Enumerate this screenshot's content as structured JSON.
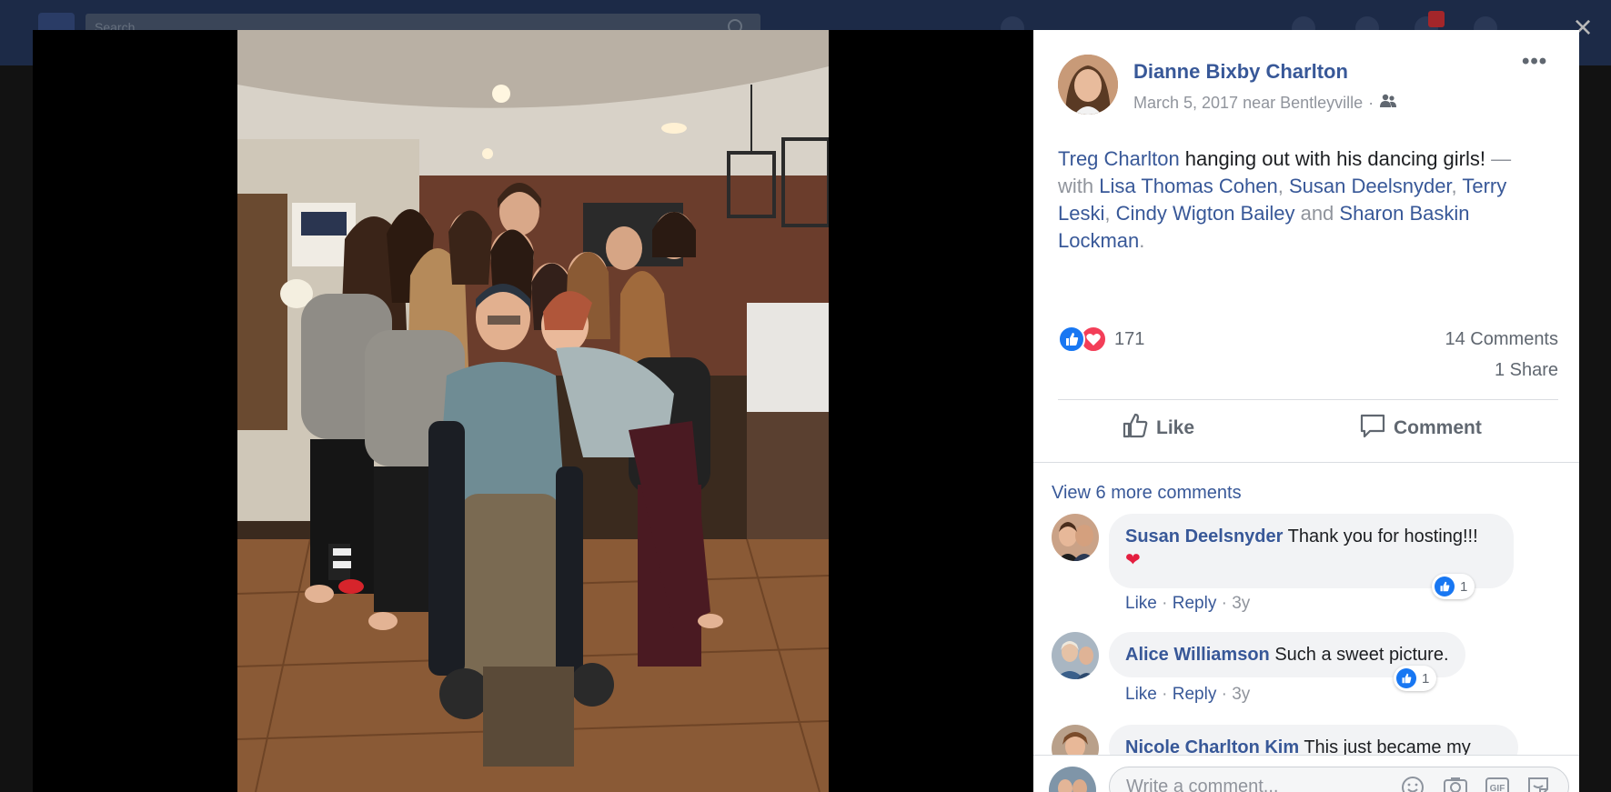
{
  "background": {
    "search_placeholder": "Search"
  },
  "close": {
    "label": "×"
  },
  "post": {
    "author": "Dianne Bixby Charlton",
    "date_location": "March 5, 2017 near Bentleyville",
    "audience_separator": "·",
    "more_label": "•••",
    "text": {
      "tagged": "Treg Charlton",
      "body": " hanging out with his dancing girls!",
      "with_prefix": " — with ",
      "people": [
        "Lisa Thomas Cohen",
        "Susan Deelsnyder",
        "Terry Leski",
        "Cindy Wigton Bailey",
        "Sharon Baskin Lockman"
      ],
      "sep1": ", ",
      "sep2": ", ",
      "sep3": ", ",
      "and": " and ",
      "end": "."
    },
    "reactions_count": "171",
    "comments_count": "14 Comments",
    "shares_count": "1 Share",
    "like_label": "Like",
    "comment_label": "Comment",
    "colors": {
      "link": "#385898",
      "like_blue": "#1877f2",
      "love_red": "#f33e58"
    }
  },
  "comments": {
    "view_more": "View 6 more comments",
    "items": [
      {
        "author": "Susan Deelsnyder",
        "text": "Thank you for hosting!!!",
        "like": "Like",
        "reply": "Reply",
        "sep": "·",
        "time": "3y",
        "reactions": "1",
        "heart": "❤"
      },
      {
        "author": "Alice Williamson",
        "text": "Such a sweet picture.",
        "like": "Like",
        "reply": "Reply",
        "sep": "·",
        "time": "3y",
        "reactions": "1"
      },
      {
        "author": "Nicole Charlton Kim",
        "text": "This just became my"
      }
    ]
  },
  "composer": {
    "placeholder": "Write a comment...",
    "icons": [
      "emoji-icon",
      "camera-icon",
      "gif-icon",
      "sticker-icon"
    ]
  }
}
